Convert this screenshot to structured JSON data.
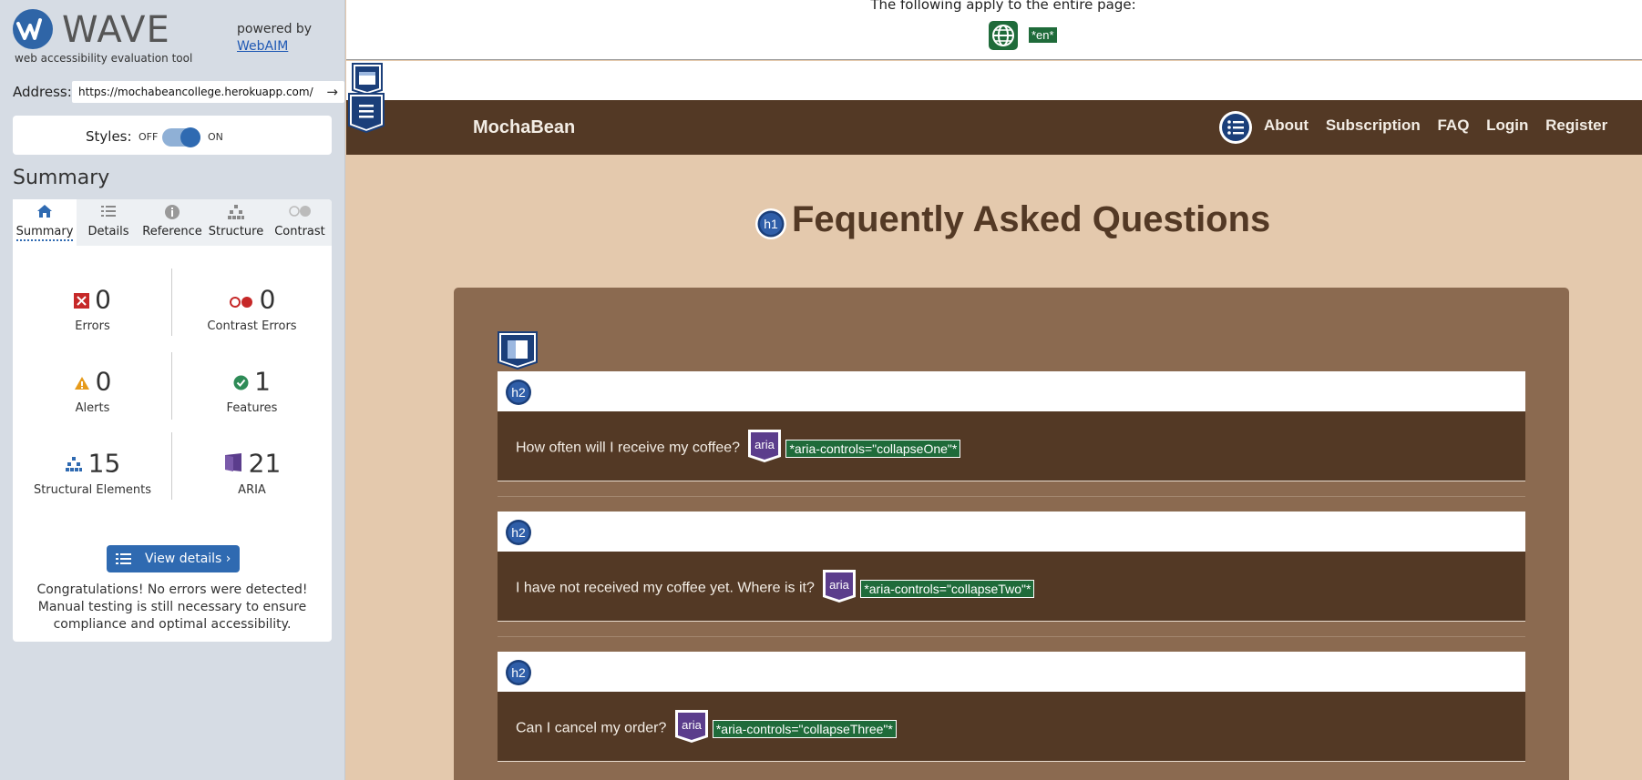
{
  "wave": {
    "brand": "WAVE",
    "tagline": "web accessibility evaluation tool",
    "powered_by": "powered by",
    "webaim_link": "WebAIM",
    "address_label": "Address:",
    "address_value": "https://mochabeancollege.herokuapp.com/",
    "styles_label": "Styles:",
    "styles_off": "OFF",
    "styles_on": "ON",
    "summary_title": "Summary",
    "tabs": [
      {
        "label": "Summary",
        "icon": "home-icon"
      },
      {
        "label": "Details",
        "icon": "list-icon"
      },
      {
        "label": "Reference",
        "icon": "info-icon"
      },
      {
        "label": "Structure",
        "icon": "hierarchy-icon"
      },
      {
        "label": "Contrast",
        "icon": "contrast-icon"
      }
    ],
    "stats": {
      "errors": {
        "count": "0",
        "label": "Errors"
      },
      "contrast_errors": {
        "count": "0",
        "label": "Contrast Errors"
      },
      "alerts": {
        "count": "0",
        "label": "Alerts"
      },
      "features": {
        "count": "1",
        "label": "Features"
      },
      "structural": {
        "count": "15",
        "label": "Structural Elements"
      },
      "aria": {
        "count": "21",
        "label": "ARIA"
      }
    },
    "view_details": "View details ›",
    "congrats": "Congratulations! No errors were detected! Manual testing is still necessary to ensure compliance and optimal accessibility."
  },
  "page": {
    "apply_text": "The following apply to the entire page:",
    "lang_tag": "*en*",
    "brand": "MochaBean",
    "nav": [
      "About",
      "Subscription",
      "FAQ",
      "Login",
      "Register"
    ],
    "h1_badge": "h1",
    "title": "Fequently Asked Questions",
    "h2_badge": "h2",
    "aria_badge": "aria",
    "questions": [
      {
        "text": "How often will I receive my coffee?",
        "code": "*aria-controls=\"collapseOne\"*"
      },
      {
        "text": "I have not received my coffee yet. Where is it?",
        "code": "*aria-controls=\"collapseTwo\"*"
      },
      {
        "text": "Can I cancel my order?",
        "code": "*aria-controls=\"collapseThree\"*"
      }
    ]
  },
  "colors": {
    "wave_blue": "#2f6ab1",
    "nav_brown": "#533925",
    "page_bg": "#e4c9ad",
    "card_brown": "#8b6a50",
    "code_green": "#1f6b3a",
    "aria_purple": "#5b3d8c"
  }
}
